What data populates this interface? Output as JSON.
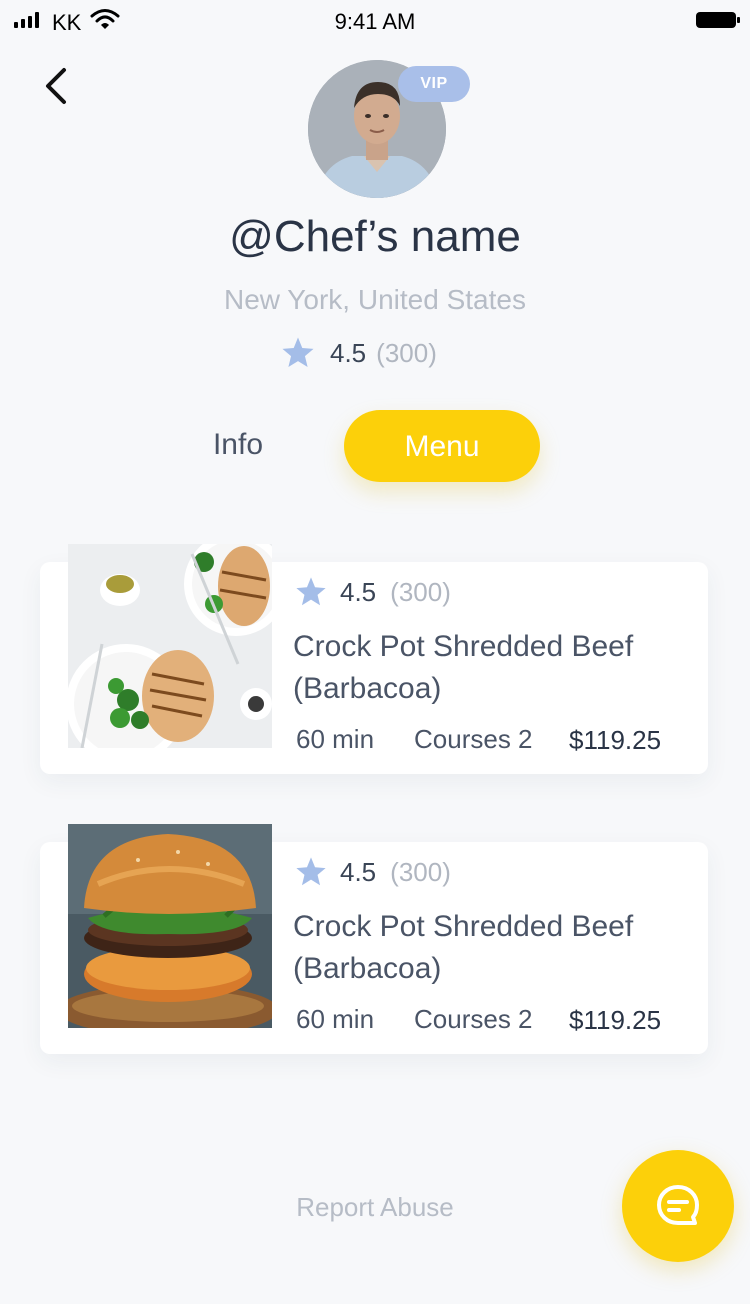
{
  "status_bar": {
    "carrier": "KK",
    "time": "9:41 AM"
  },
  "profile": {
    "vip_label": "VIP",
    "name": "@Chef’s name",
    "location": "New York, United States",
    "rating": "4.5",
    "rating_count": "(300)"
  },
  "tabs": {
    "info_label": "Info",
    "menu_label": "Menu",
    "active": "Menu"
  },
  "menu_items": [
    {
      "image": "grilled-chicken-broccoli-photo",
      "rating": "4.5",
      "rating_count": "(300)",
      "title": "Crock Pot Shredded Beef (Barbacoa)",
      "time": "60 min",
      "courses": "Courses 2",
      "price": "$119.25"
    },
    {
      "image": "burger-photo",
      "rating": "4.5",
      "rating_count": "(300)",
      "title": "Crock Pot Shredded Beef (Barbacoa)",
      "time": "60 min",
      "courses": "Courses 2",
      "price": "$119.25"
    }
  ],
  "footer": {
    "report_label": "Report Abuse"
  },
  "icons": {
    "back": "chevron-left-icon",
    "star": "star-icon",
    "chat": "chat-bubble-icon"
  },
  "colors": {
    "accent": "#fcd00a",
    "vip_badge": "#a9bfe9",
    "star": "#a4bde8",
    "background": "#f7f8fa"
  }
}
